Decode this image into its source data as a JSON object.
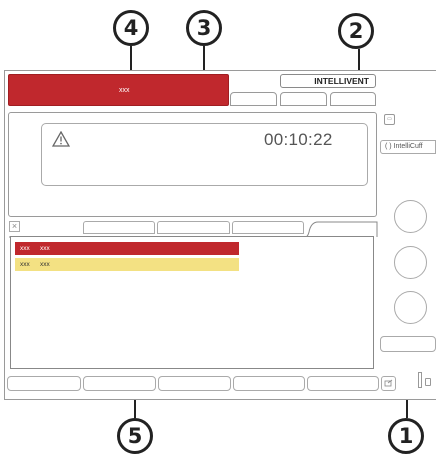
{
  "callouts": {
    "c1": "1",
    "c2": "2",
    "c3": "3",
    "c4": "4",
    "c5": "5"
  },
  "header": {
    "alarm_text": "xxx",
    "mode_label": "INTELLIVENT"
  },
  "status": {
    "warning_icon": "warning-triangle-icon",
    "timer": "00:10:22"
  },
  "sidebar": {
    "intellicuff_label": "( ) IntelliCuff"
  },
  "alarm_list": {
    "rows": [
      {
        "col1": "xxx",
        "col2": "xxx",
        "level": "high",
        "color": "#c0282d"
      },
      {
        "col1": "xxx",
        "col2": "xxx",
        "level": "medium",
        "color": "#f3e183"
      }
    ]
  },
  "close_label": "×"
}
